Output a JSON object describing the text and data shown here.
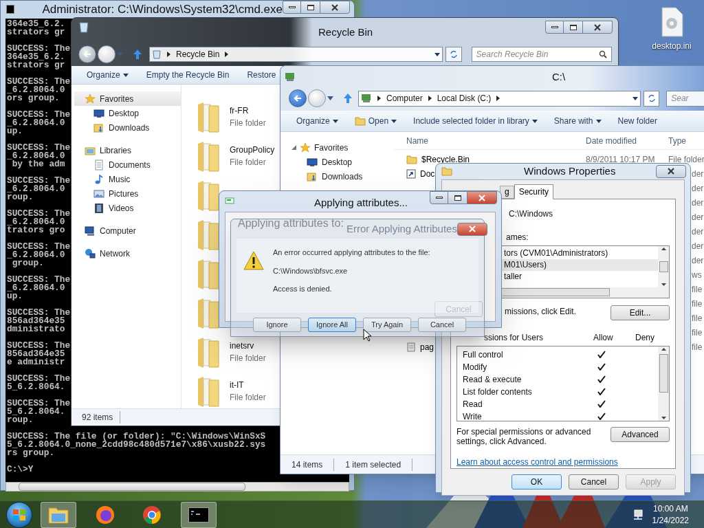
{
  "desktop": {
    "icons": [
      {
        "label": "desktop.ini"
      }
    ]
  },
  "cmd": {
    "title": "Administrator: C:\\Windows\\System32\\cmd.exe",
    "blocks": [
      {
        "lines": [
          "364e35_6.2.",
          "strators gr"
        ]
      },
      {
        "lines": [
          "SUCCESS: The",
          "364e35_6.2.",
          "strators gr"
        ]
      },
      {
        "lines": [
          "SUCCESS: The",
          "_6.2.8064.0",
          "ors group."
        ]
      },
      {
        "lines": [
          "SUCCESS: The",
          "_6.2.8064.0",
          "up."
        ]
      },
      {
        "lines": [
          "SUCCESS: The",
          "_6.2.8064.0",
          " by the adm"
        ]
      },
      {
        "lines": [
          "SUCCESS: The",
          "_6.2.8064.0",
          "roup."
        ]
      },
      {
        "lines": [
          "SUCCESS: The",
          "_6.2.8064.0",
          "trators gro"
        ]
      },
      {
        "lines": [
          "SUCCESS: The",
          "_6.2.8064.0",
          " group."
        ]
      },
      {
        "lines": [
          "SUCCESS: The",
          "_6.2.8064.0",
          "up."
        ]
      },
      {
        "lines": [
          "SUCCESS: The",
          "856ad364e35",
          "dministrato"
        ]
      },
      {
        "lines": [
          "SUCCESS: The",
          "856ad364e35",
          "e administr"
        ]
      },
      {
        "lines": [
          "SUCCESS: The",
          "5_6.2.8064."
        ]
      },
      {
        "lines": [
          "SUCCESS: The",
          "5_6.2.8064.",
          "roup."
        ]
      },
      {
        "lines": [
          "SUCCESS: The file (or folder): \"C:\\Windows\\WinSxS",
          "5_6.2.8064.0_none_2cdd98c480d571e7\\x86\\xusb22.sys",
          "rs group."
        ]
      },
      {
        "lines": [
          "C:\\>Y"
        ]
      }
    ]
  },
  "recycle_bin": {
    "title": "Recycle Bin",
    "breadcrumb": [
      "Recycle Bin"
    ],
    "search": {
      "placeholder": "Search Recycle Bin"
    },
    "toolbar": [
      {
        "label": "Organize",
        "dropdown": true
      },
      {
        "label": "Empty the Recycle Bin",
        "dropdown": false
      },
      {
        "label": "Restore",
        "dropdown": false
      }
    ],
    "nav": [
      {
        "label": "Favorites",
        "kind": "star",
        "selected": true,
        "children": [
          {
            "label": "Desktop",
            "kind": "desktop",
            "selected": false
          },
          {
            "label": "Downloads",
            "kind": "downloads",
            "selected": false
          }
        ]
      },
      {
        "label": "Libraries",
        "kind": "library",
        "selected": false,
        "children": [
          {
            "label": "Documents",
            "kind": "documents",
            "selected": false
          },
          {
            "label": "Music",
            "kind": "music",
            "selected": false
          },
          {
            "label": "Pictures",
            "kind": "pictures",
            "selected": false
          },
          {
            "label": "Videos",
            "kind": "videos",
            "selected": false
          }
        ]
      },
      {
        "label": "Computer",
        "kind": "computer",
        "selected": false
      },
      {
        "label": "Network",
        "kind": "network",
        "selected": false
      }
    ],
    "items": [
      {
        "kind": "folder",
        "name": "fr-FR",
        "type": "File folder"
      },
      {
        "kind": "folder",
        "name": "GroupPolicy",
        "type": "File folder"
      },
      {
        "kind": "folder"
      },
      {
        "kind": "folder"
      },
      {
        "kind": "folder"
      },
      {
        "kind": "folder"
      },
      {
        "kind": "folder",
        "name": "inetsrv",
        "type": "File folder"
      },
      {
        "kind": "folder",
        "name": "it-IT",
        "type": "File folder"
      }
    ],
    "status": "92 items"
  },
  "c_drive": {
    "title": "C:\\",
    "breadcrumb": [
      "Computer",
      "Local Disk (C:)"
    ],
    "search": {
      "placeholder": "Sear"
    },
    "toolbar": [
      {
        "label": "Organize",
        "dropdown": true
      },
      {
        "label": "Open",
        "dropdown": true
      },
      {
        "label": "Include selected folder in library",
        "dropdown": true
      },
      {
        "label": "Share with",
        "dropdown": true
      },
      {
        "label": "New folder",
        "dropdown": false
      }
    ],
    "nav": [
      {
        "label": "Favorites",
        "expanded": true,
        "children": [
          {
            "label": "Desktop",
            "kind": "desktop"
          },
          {
            "label": "Downloads",
            "kind": "downloads"
          }
        ]
      }
    ],
    "columns": [
      "Name",
      "Date modified",
      "Type"
    ],
    "rows": [
      {
        "kind": "folder",
        "name": "$Recycle.Bin",
        "date": "8/9/2011 10:17 PM",
        "type": "File folder"
      },
      {
        "kind": "shortcut",
        "name": "Doc",
        "type": "der"
      },
      {
        "type": "der"
      },
      {
        "type": "der"
      },
      {
        "type": "der"
      },
      {
        "type": "der"
      },
      {
        "type": "der"
      },
      {
        "type": "der"
      },
      {
        "type": "ws"
      },
      {
        "type": "file"
      },
      {
        "type": "file"
      },
      {
        "type": "file"
      },
      {
        "type": "file"
      },
      {
        "kind": "file",
        "name": "pag",
        "type": "file"
      }
    ],
    "status": [
      "14 items",
      "1 item selected"
    ]
  },
  "properties": {
    "title": "Windows Properties",
    "tabs": [
      {
        "label": "g",
        "selected": false
      },
      {
        "label": "Security",
        "selected": true
      }
    ],
    "object_name": "C:\\Windows",
    "names_label": "ames:",
    "principals": [
      {
        "name": "tors (CVM01\\Administrators)",
        "selected": false
      },
      {
        "name": "M01\\Users)",
        "selected": true
      },
      {
        "name": "taller",
        "selected": false
      }
    ],
    "edit_hint": "missions, click Edit.",
    "edit_button": "Edit...",
    "permissions_label": "ssions for Users",
    "allow_label": "Allow",
    "deny_label": "Deny",
    "permissions": [
      {
        "name": "Full control",
        "allow": true,
        "deny": false
      },
      {
        "name": "Modify",
        "allow": true,
        "deny": false
      },
      {
        "name": "Read & execute",
        "allow": true,
        "deny": false
      },
      {
        "name": "List folder contents",
        "allow": true,
        "deny": false
      },
      {
        "name": "Read",
        "allow": true,
        "deny": false
      },
      {
        "name": "Write",
        "allow": true,
        "deny": false
      }
    ],
    "advanced_hint": "For special permissions or advanced settings, click Advanced.",
    "advanced_button": "Advanced",
    "link": "Learn about access control and permissions",
    "buttons": [
      {
        "label": "OK",
        "default": true,
        "disabled": false
      },
      {
        "label": "Cancel",
        "default": false,
        "disabled": false
      },
      {
        "label": "Apply",
        "default": false,
        "disabled": true
      }
    ]
  },
  "applying": {
    "title": "Applying attributes...",
    "label": "Applying attributes to:",
    "cancel": {
      "label": "Cancel",
      "disabled": true
    }
  },
  "error_dialog": {
    "title": "Error Applying Attributes",
    "message": "An error occurred applying attributes to the file:",
    "path": "C:\\Windows\\bfsvc.exe",
    "detail": "Access is denied.",
    "buttons": [
      {
        "label": "Ignore",
        "focused": false
      },
      {
        "label": "Ignore All",
        "focused": true
      },
      {
        "label": "Try Again",
        "focused": false
      },
      {
        "label": "Cancel",
        "focused": false
      }
    ]
  },
  "taskbar": {
    "apps": [
      {
        "kind": "explorer",
        "active": true
      },
      {
        "kind": "firefox",
        "active": false
      },
      {
        "kind": "chrome",
        "active": false
      },
      {
        "kind": "cmd",
        "active": true
      }
    ],
    "time": "10:00 AM",
    "date": "1/24/2022"
  }
}
